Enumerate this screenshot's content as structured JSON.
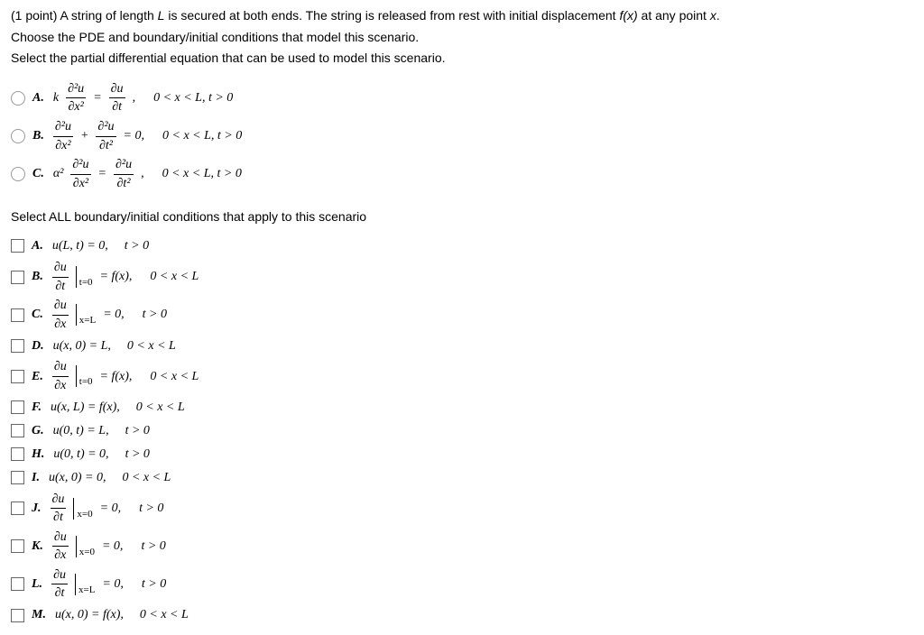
{
  "problem": {
    "points": "(1 point)",
    "text1": " A string of length ",
    "Lvar": "L",
    "text2": " is secured at both ends. The string is released from rest with initial displacement ",
    "fvar": "f(x)",
    "text3": " at any point ",
    "xvar": "x",
    "text4": ".",
    "line2": "Choose the PDE and boundary/initial conditions that model this scenario.",
    "line3": "Select the partial differential equation that can be used to model this scenario."
  },
  "pde": {
    "A": {
      "label": "A.",
      "domain": "0 < x < L, t > 0"
    },
    "B": {
      "label": "B.",
      "eq0": "= 0,",
      "domain": "0 < x < L, t > 0"
    },
    "C": {
      "label": "C.",
      "domain": "0 < x < L, t > 0"
    }
  },
  "prompt2": "Select ALL boundary/initial conditions that apply to this scenario",
  "cond": {
    "A": {
      "label": "A.",
      "eq": "u(L, t) = 0,",
      "dom": "t > 0"
    },
    "B": {
      "label": "B.",
      "rhs": "= f(x),",
      "dom": "0 < x < L"
    },
    "C": {
      "label": "C.",
      "rhs": "= 0,",
      "dom": "t > 0"
    },
    "D": {
      "label": "D.",
      "eq": "u(x, 0) = L,",
      "dom": "0 < x < L"
    },
    "E": {
      "label": "E.",
      "rhs": "= f(x),",
      "dom": "0 < x < L"
    },
    "F": {
      "label": "F.",
      "eq": "u(x, L) = f(x),",
      "dom": "0 < x < L"
    },
    "G": {
      "label": "G.",
      "eq": "u(0, t) = L,",
      "dom": "t > 0"
    },
    "H": {
      "label": "H.",
      "eq": "u(0, t) = 0,",
      "dom": "t > 0"
    },
    "I": {
      "label": "I.",
      "eq": "u(x, 0) = 0,",
      "dom": "0 < x < L"
    },
    "J": {
      "label": "J.",
      "rhs": "= 0,",
      "dom": "t > 0"
    },
    "K": {
      "label": "K.",
      "rhs": "= 0,",
      "dom": "t > 0"
    },
    "L": {
      "label": "L.",
      "rhs": "= 0,",
      "dom": "t > 0"
    },
    "M": {
      "label": "M.",
      "eq": "u(x, 0) = f(x),",
      "dom": "0 < x < L"
    }
  },
  "partial": {
    "du": "∂u",
    "dt": "∂t",
    "dx": "∂x",
    "d2u": "∂²u",
    "dt2": "∂t²",
    "dx2": "∂x²"
  },
  "sym": {
    "k": "k",
    "alpha2": "α²",
    "eq": "=",
    "plus": "+",
    "comma": ","
  },
  "subs": {
    "t0": "t=0",
    "x0": "x=0",
    "xL": "x=L"
  }
}
